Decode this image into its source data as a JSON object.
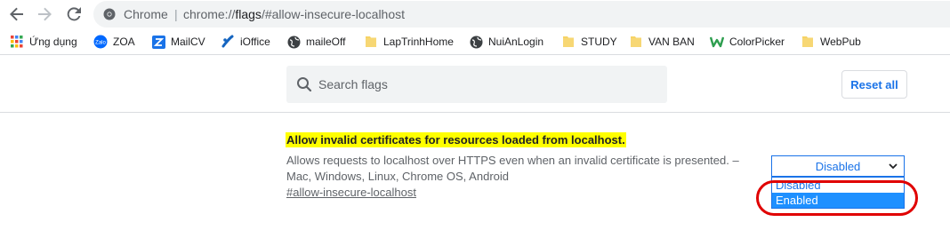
{
  "toolbar": {
    "site_label": "Chrome",
    "separator": "|",
    "url_prefix": "chrome://",
    "url_host": "flags",
    "url_rest": "/#allow-insecure-localhost"
  },
  "bookmarks": [
    {
      "label": "Ứng dụng",
      "icon": "apps-grid-icon"
    },
    {
      "label": "ZOA",
      "icon": "zalo-icon"
    },
    {
      "label": "MailCV",
      "icon": "z-logo-icon"
    },
    {
      "label": "iOffice",
      "icon": "ioffice-icon"
    },
    {
      "label": "maileOff",
      "icon": "globe-icon"
    },
    {
      "label": "LapTrinhHome",
      "icon": "folder-icon"
    },
    {
      "label": "NuiAnLogin",
      "icon": "globe-icon"
    },
    {
      "label": "STUDY",
      "icon": "folder-icon"
    },
    {
      "label": "VAN BAN",
      "icon": "folder-icon"
    },
    {
      "label": "ColorPicker",
      "icon": "w-logo-icon"
    },
    {
      "label": "WebPub",
      "icon": "folder-icon"
    }
  ],
  "search": {
    "placeholder": "Search flags"
  },
  "reset_label": "Reset all",
  "flag": {
    "title": "Allow invalid certificates for resources loaded from localhost.",
    "desc_line1": "Allows requests to localhost over HTTPS even when an invalid certificate is presented. –",
    "desc_line2": "Mac, Windows, Linux, Chrome OS, Android",
    "link": "#allow-insecure-localhost",
    "selected_value": "Disabled",
    "options": [
      "Disabled",
      "Enabled"
    ],
    "highlighted_option": "Enabled"
  },
  "colors": {
    "accent": "#1a73e8",
    "highlight": "#ffff00",
    "annotation": "#e00000",
    "selected_option_bg": "#1e90ff"
  }
}
